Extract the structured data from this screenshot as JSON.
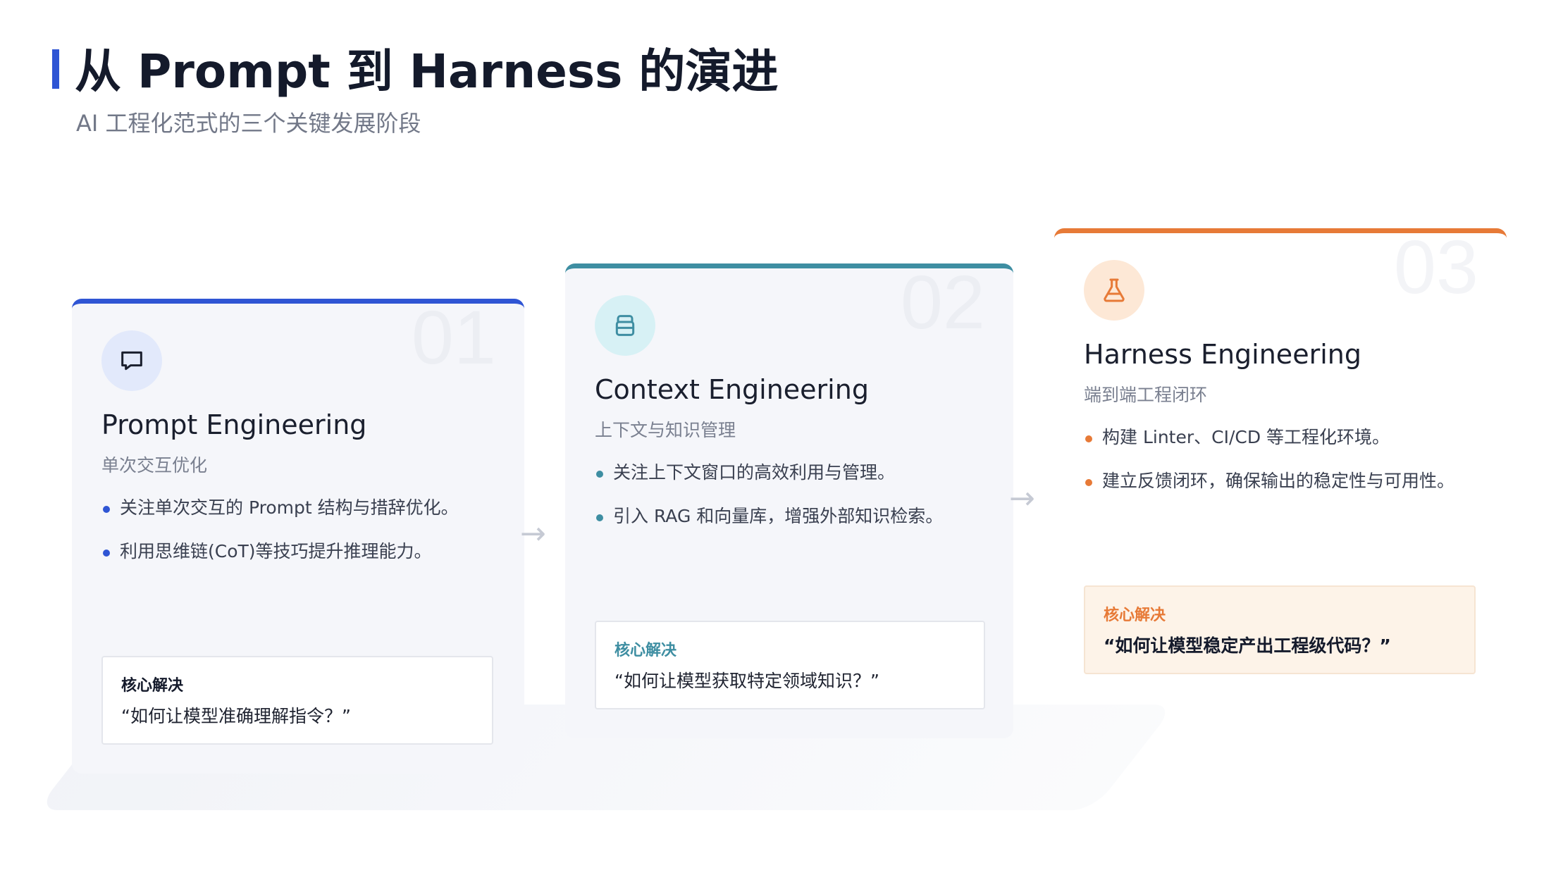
{
  "header": {
    "title": "从 Prompt 到 Harness 的演进",
    "subtitle": "AI 工程化范式的三个关键发展阶段"
  },
  "colors": {
    "prompt_accent": "#2f55d4",
    "context_accent": "#3e8ea2",
    "harness_accent": "#e77a37"
  },
  "arrows": [
    "→",
    "→"
  ],
  "cards": [
    {
      "number": "01",
      "icon": "chat-bubble-icon",
      "title": "Prompt Engineering",
      "subtitle": "单次交互优化",
      "points": [
        "关注单次交互的 Prompt 结构与措辞优化。",
        "利用思维链(CoT)等技巧提升推理能力。"
      ],
      "core_label": "核心解决",
      "core_text": "“如何让模型准确理解指令？”"
    },
    {
      "number": "02",
      "icon": "database-icon",
      "title": "Context Engineering",
      "subtitle": "上下文与知识管理",
      "points": [
        "关注上下文窗口的高效利用与管理。",
        "引入 RAG 和向量库，增强外部知识检索。"
      ],
      "core_label": "核心解决",
      "core_text": "“如何让模型获取特定领域知识？”"
    },
    {
      "number": "03",
      "icon": "flask-icon",
      "title": "Harness Engineering",
      "subtitle": "端到端工程闭环",
      "points": [
        "构建 Linter、CI/CD 等工程化环境。",
        "建立反馈闭环，确保输出的稳定性与可用性。"
      ],
      "core_label": "核心解决",
      "core_text": "“如何让模型稳定产出工程级代码？”"
    }
  ]
}
